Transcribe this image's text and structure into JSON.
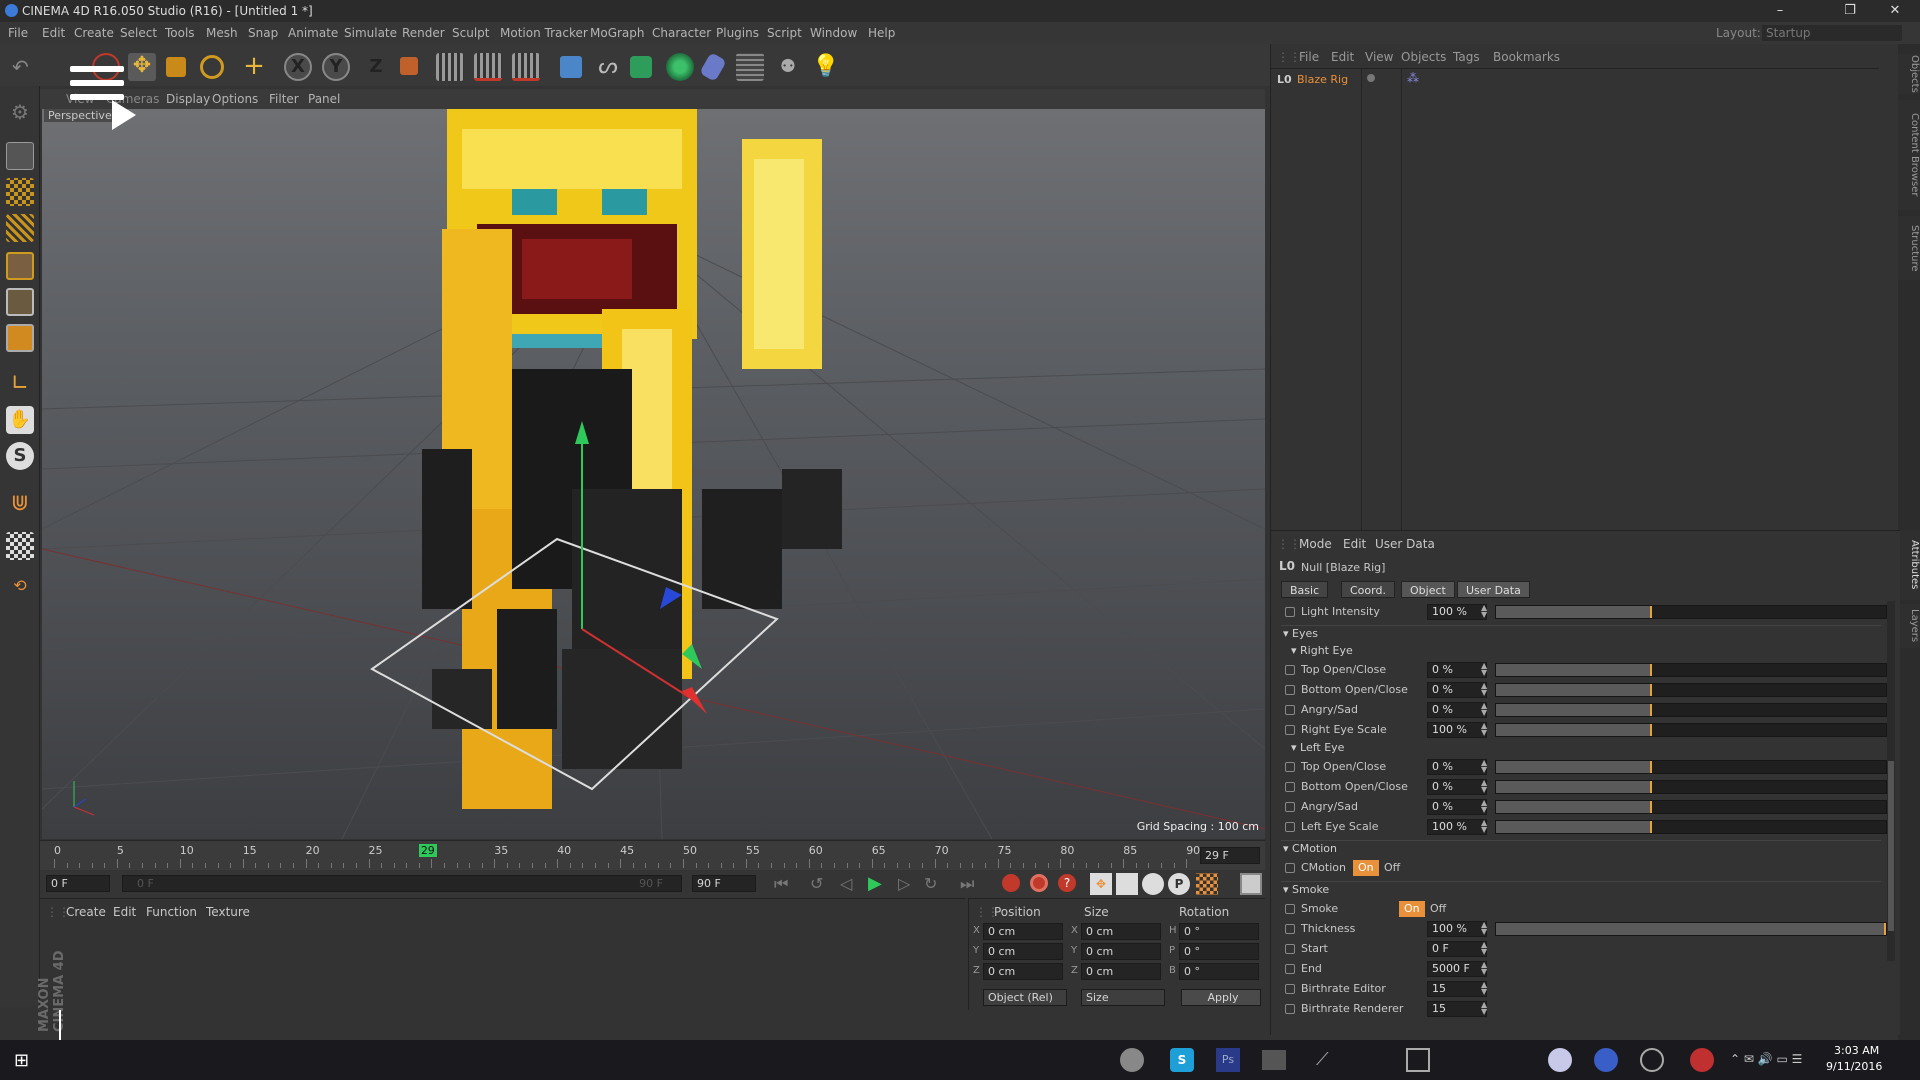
{
  "window": {
    "title": "CINEMA 4D R16.050 Studio (R16) - [Untitled 1 *]",
    "layout_label": "Layout:",
    "layout_value": "Startup"
  },
  "menu": [
    "File",
    "Edit",
    "Create",
    "Select",
    "Tools",
    "Mesh",
    "Snap",
    "Animate",
    "Simulate",
    "Render",
    "Sculpt",
    "Motion Tracker",
    "MoGraph",
    "Character",
    "Plugins",
    "Script",
    "Window",
    "Help"
  ],
  "toolbar": {
    "axis_x": "X",
    "axis_y": "Y",
    "axis_z": "Z"
  },
  "viewport": {
    "menu": [
      "View",
      "Cameras",
      "Display",
      "Options",
      "Filter",
      "Panel"
    ],
    "name": "Perspective",
    "grid_spacing": "Grid Spacing : 100 cm"
  },
  "timeline": {
    "ticks": [
      "0",
      "5",
      "10",
      "15",
      "20",
      "25",
      "29",
      "35",
      "40",
      "45",
      "50",
      "55",
      "60",
      "65",
      "70",
      "75",
      "80",
      "85",
      "90"
    ],
    "current_frame": "29 F",
    "start_field": "0 F",
    "end_field": "90 F",
    "range_start_ghost": "0 F",
    "range_end_ghost": "90 F"
  },
  "objects_panel": {
    "menu": [
      "File",
      "Edit",
      "View",
      "Objects",
      "Tags",
      "Bookmarks"
    ],
    "item": "Blaze Rig"
  },
  "side_tabs": {
    "top": [
      "Objects",
      "Content Browser",
      "Structure"
    ],
    "bottom": [
      "Attributes",
      "Layers"
    ]
  },
  "attributes": {
    "menu": [
      "Mode",
      "Edit",
      "User Data"
    ],
    "title": "Null [Blaze Rig]",
    "tabs": [
      "Basic",
      "Coord.",
      "Object",
      "User Data"
    ],
    "light_intensity": {
      "label": "Light Intensity",
      "value": "100 %"
    },
    "eyes_group": "Eyes",
    "right_eye_group": "Right Eye",
    "right_eye": [
      {
        "label": "Top Open/Close",
        "value": "0 %"
      },
      {
        "label": "Bottom Open/Close",
        "value": "0 %"
      },
      {
        "label": "Angry/Sad",
        "value": "0 %"
      },
      {
        "label": "Right Eye Scale",
        "value": "100 %"
      }
    ],
    "left_eye_group": "Left Eye",
    "left_eye": [
      {
        "label": "Top Open/Close",
        "value": "0 %"
      },
      {
        "label": "Bottom Open/Close",
        "value": "0 %"
      },
      {
        "label": "Angry/Sad",
        "value": "0 %"
      },
      {
        "label": "Left Eye Scale",
        "value": "100 %"
      }
    ],
    "cmotion_group": "CMotion",
    "cmotion": {
      "label": "CMotion",
      "on": "On",
      "off": "Off"
    },
    "smoke_group": "Smoke",
    "smoke": {
      "label": "Smoke",
      "on": "On",
      "off": "Off"
    },
    "thickness": {
      "label": "Thickness",
      "value": "100 %"
    },
    "start": {
      "label": "Start",
      "value": "0 F"
    },
    "end": {
      "label": "End",
      "value": "5000 F"
    },
    "birthrate_editor": {
      "label": "Birthrate Editor",
      "value": "15"
    },
    "birthrate_renderer": {
      "label": "Birthrate Renderer",
      "value": "15"
    }
  },
  "material_panel": {
    "menu": [
      "Create",
      "Edit",
      "Function",
      "Texture"
    ],
    "brand": "MAXON CINEMA 4D"
  },
  "coords": {
    "headers": [
      "Position",
      "Size",
      "Rotation"
    ],
    "pos": [
      {
        "axis": "X",
        "value": "0 cm"
      },
      {
        "axis": "Y",
        "value": "0 cm"
      },
      {
        "axis": "Z",
        "value": "0 cm"
      }
    ],
    "size": [
      {
        "axis": "X",
        "value": "0 cm"
      },
      {
        "axis": "Y",
        "value": "0 cm"
      },
      {
        "axis": "Z",
        "value": "0 cm"
      }
    ],
    "rot": [
      {
        "axis": "H",
        "value": "0 °"
      },
      {
        "axis": "P",
        "value": "0 °"
      },
      {
        "axis": "B",
        "value": "0 °"
      }
    ],
    "mode": "Object (Rel)",
    "size_mode": "Size",
    "apply": "Apply"
  },
  "taskbar": {
    "time": "3:03 AM",
    "date": "9/11/2016"
  },
  "video": {
    "progress_fraction": 0.54
  }
}
